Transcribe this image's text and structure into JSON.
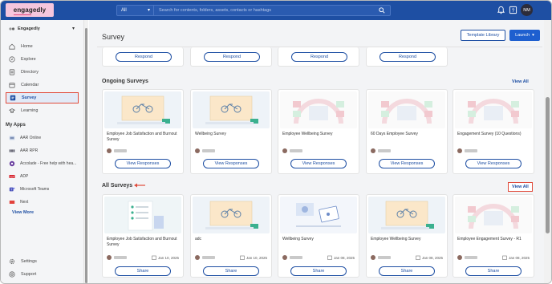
{
  "topbar": {
    "logo_text": "engagedly",
    "search_scope": "All",
    "search_placeholder": "Search for contents, folders, assets, contacts or hashtags",
    "avatar_initials": "NM",
    "colors": {
      "bar": "#1e4fa3",
      "logo_bg": "#f6c6dd"
    }
  },
  "sidebar": {
    "org_name": "Engagedly",
    "nav": [
      {
        "label": "Home",
        "icon": "home-icon"
      },
      {
        "label": "Explore",
        "icon": "compass-icon"
      },
      {
        "label": "Directory",
        "icon": "directory-icon"
      },
      {
        "label": "Calendar",
        "icon": "calendar-icon"
      },
      {
        "label": "Survey",
        "icon": "survey-icon",
        "active": true
      },
      {
        "label": "Learning",
        "icon": "learning-icon"
      }
    ],
    "apps_title": "My Apps",
    "apps": [
      {
        "label": "AAR Online",
        "icon": "aar-icon"
      },
      {
        "label": "AAR RPR",
        "icon": "aar-rpr-icon"
      },
      {
        "label": "Accolade - Free help with hea...",
        "icon": "accolade-icon"
      },
      {
        "label": "ADP",
        "icon": "adp-icon"
      },
      {
        "label": "Microsoft Teams",
        "icon": "teams-icon"
      },
      {
        "label": "Next",
        "icon": "next-icon"
      }
    ],
    "view_more": "View More",
    "footer": [
      {
        "label": "Settings",
        "icon": "gear-icon"
      },
      {
        "label": "Support",
        "icon": "support-icon"
      }
    ]
  },
  "page": {
    "title": "Survey",
    "template_library": "Template Library",
    "launch": "Launch"
  },
  "top_row": {
    "button": "Respond"
  },
  "ongoing": {
    "title": "Ongoing Surveys",
    "view_all": "View All",
    "cards": [
      {
        "title": "Employee Job Satisfaction and Burnout Survey",
        "author": "Ranjit Nagi",
        "button": "View Responses",
        "thumb": "bike"
      },
      {
        "title": "Wellbeing Survey",
        "author": "Ranjit Nagi",
        "button": "View Responses",
        "thumb": "bike"
      },
      {
        "title": "Employee Wellbeing Survey",
        "author": "Ranjit Nagi",
        "button": "View Responses",
        "thumb": "faded"
      },
      {
        "title": "60 Days Employee Survey",
        "author": "Ranjit Nagi",
        "button": "View Responses",
        "thumb": "faded"
      },
      {
        "title": "Engagement Survey (10 Questions)",
        "author": "Ranjit Nagi",
        "button": "View Responses",
        "thumb": "faded"
      }
    ]
  },
  "all": {
    "title": "All Surveys",
    "view_all": "View All",
    "cards": [
      {
        "title": "Employee Job Satisfaction and Burnout Survey",
        "author": "Ranjit Nagi",
        "date": "Jan 10, 2025",
        "button": "Share",
        "thumb": "list"
      },
      {
        "title": "adc",
        "author": "Ranjit Nagi",
        "date": "Jan 10, 2025",
        "button": "Share",
        "thumb": "bike"
      },
      {
        "title": "Wellbeing Survey",
        "author": "Ranjit Nagi",
        "date": "Jan 08, 2025",
        "button": "Share",
        "thumb": "laptop"
      },
      {
        "title": "Employee Wellbeing Survey",
        "author": "Ranjit Nagi",
        "date": "Jan 08, 2025",
        "button": "Share",
        "thumb": "bike"
      },
      {
        "title": "Employee Engagement Survey - R1",
        "author": "Ranjit Nagi",
        "date": "Jan 08, 2025",
        "button": "Share",
        "thumb": "faded"
      }
    ]
  }
}
